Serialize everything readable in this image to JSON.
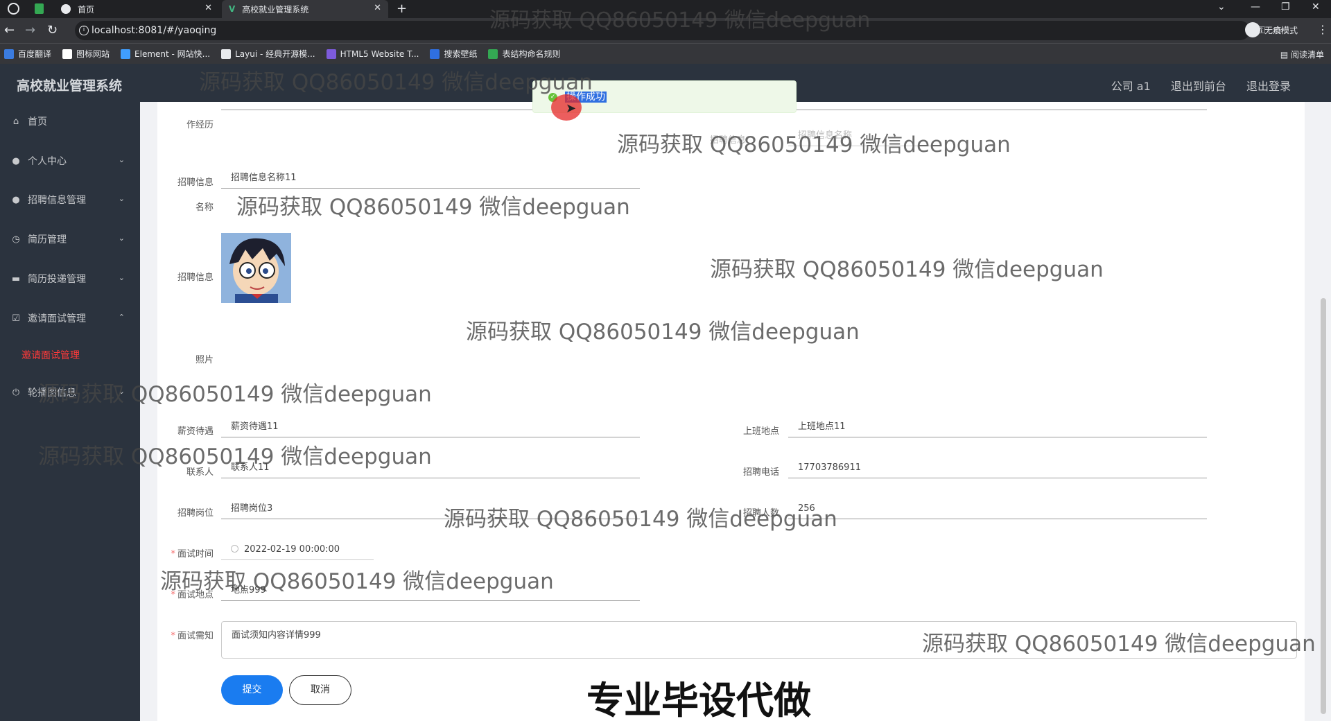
{
  "browser": {
    "tabs": [
      {
        "title": "首页"
      },
      {
        "title": "高校就业管理系统"
      }
    ],
    "url": "localhost:8081/#/yaoqing",
    "incognito_label": "无痕模式",
    "reading_list": "阅读清单",
    "bookmarks": [
      "百度翻译",
      "图标网站",
      "Element - 网站快...",
      "Layui - 经典开源模...",
      "HTML5 Website T...",
      "搜索壁纸",
      "表结构命名规则"
    ]
  },
  "app": {
    "title": "高校就业管理系统",
    "header_links": [
      "公司 a1",
      "退出到前台",
      "退出登录"
    ]
  },
  "sidebar": {
    "items": [
      {
        "label": "首页",
        "icon": "home-icon"
      },
      {
        "label": "个人中心",
        "icon": "user-icon"
      },
      {
        "label": "招聘信息管理",
        "icon": "user-icon"
      },
      {
        "label": "简历管理",
        "icon": "clock-icon"
      },
      {
        "label": "简历投递管理",
        "icon": "briefcase-icon"
      },
      {
        "label": "邀请面试管理",
        "icon": "check-square-icon"
      },
      {
        "label": "轮播图信息",
        "icon": "power-icon"
      }
    ],
    "active_sub": "邀请面试管理"
  },
  "form": {
    "work_history_label": "作经历",
    "job_name_label_1": "招聘信息",
    "job_name_label_2": "名称",
    "job_name_value": "招聘信息名称11",
    "photo_label_1": "招聘信息",
    "photo_label_2": "照片",
    "salary_label": "薪资待遇",
    "salary_value": "薪资待遇11",
    "work_place_label": "上班地点",
    "work_place_value": "上班地点11",
    "contact_label": "联系人",
    "contact_value": "联系人11",
    "phone_label": "招聘电话",
    "phone_value": "17703786911",
    "position_label": "招聘岗位",
    "position_value": "招聘岗位3",
    "count_label": "招聘人数",
    "count_value": "256",
    "faded_label": "招聘信息",
    "faded_value": "招聘信息名称",
    "interview_time_label": "面试时间",
    "interview_time_value": "2022-02-19 00:00:00",
    "interview_place_label": "面试地点",
    "interview_place_value": "地点999",
    "notice_label": "面试需知",
    "notice_value": "面试须知内容详情999",
    "submit": "提交",
    "cancel": "取消"
  },
  "toast": {
    "message": "操作成功"
  },
  "watermark": "源码获取 QQ86050149 微信deepguan",
  "banner": "专业毕设代做"
}
